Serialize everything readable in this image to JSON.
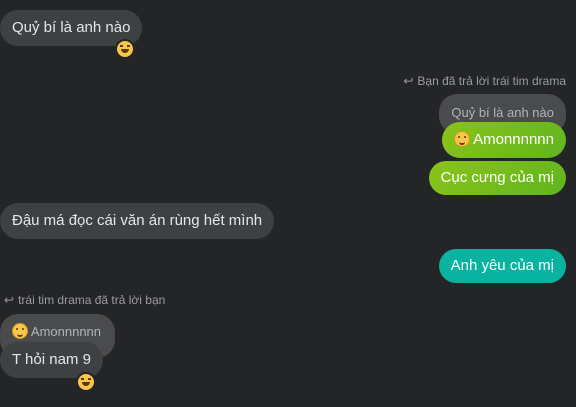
{
  "messages": {
    "m1": "Quỷ bí là anh nào",
    "reply_note_1": "Bạn đã trả lời trái tim drama",
    "quote_1": "Quỷ bí là anh nào",
    "m2": "Amonnnnnn",
    "m3": "Cục cưng của mị",
    "m4": "Đậu má đọc cái văn án rùng hết mình",
    "m5": "Anh yêu của mị",
    "reply_note_2": "trái tim drama đã trả lời bạn",
    "quote_2": "Amonnnnnn",
    "m6": "T hỏi nam 9"
  },
  "icons": {
    "reply_arrow": "reply-arrow-icon",
    "reaction": "laughing-emoji-icon",
    "inline_emoji": "smile-emoji-icon"
  },
  "colors": {
    "background": "#242526",
    "incoming_bubble": "#3e4042",
    "green_bubble": "#7dbd1c",
    "teal_bubble": "#0ab39f"
  }
}
